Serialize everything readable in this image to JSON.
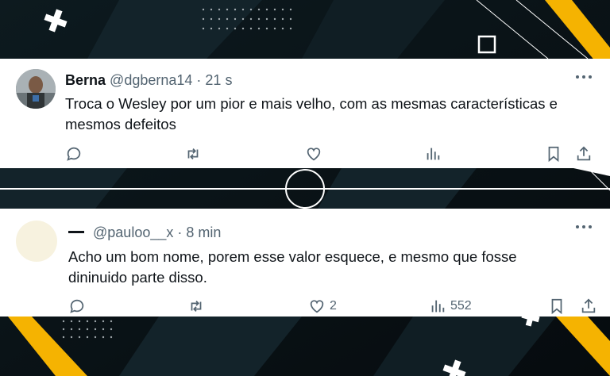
{
  "tweets": [
    {
      "name": "Berna",
      "handle": "@dgberna14",
      "time": "· 21 s",
      "text": "Troca o Wesley por um pior e mais velho, com as mesmas características e mesmos defeitos",
      "likes": "",
      "views": ""
    },
    {
      "name": "",
      "handle": "@pauloo__x",
      "time": "· 8 min",
      "text": "Acho um bom nome, porem esse valor esquece, e mesmo que fosse dininuido parte disso.",
      "likes": "2",
      "views": "552"
    }
  ],
  "icons": {
    "reply": "reply-icon",
    "retweet": "retweet-icon",
    "like": "heart-icon",
    "views": "views-icon",
    "bookmark": "bookmark-icon",
    "share": "share-icon",
    "more": "more-icon"
  },
  "colors": {
    "accent": "#f5b301",
    "background": "#0b1418",
    "text": "#0f1419",
    "secondary": "#536471"
  }
}
